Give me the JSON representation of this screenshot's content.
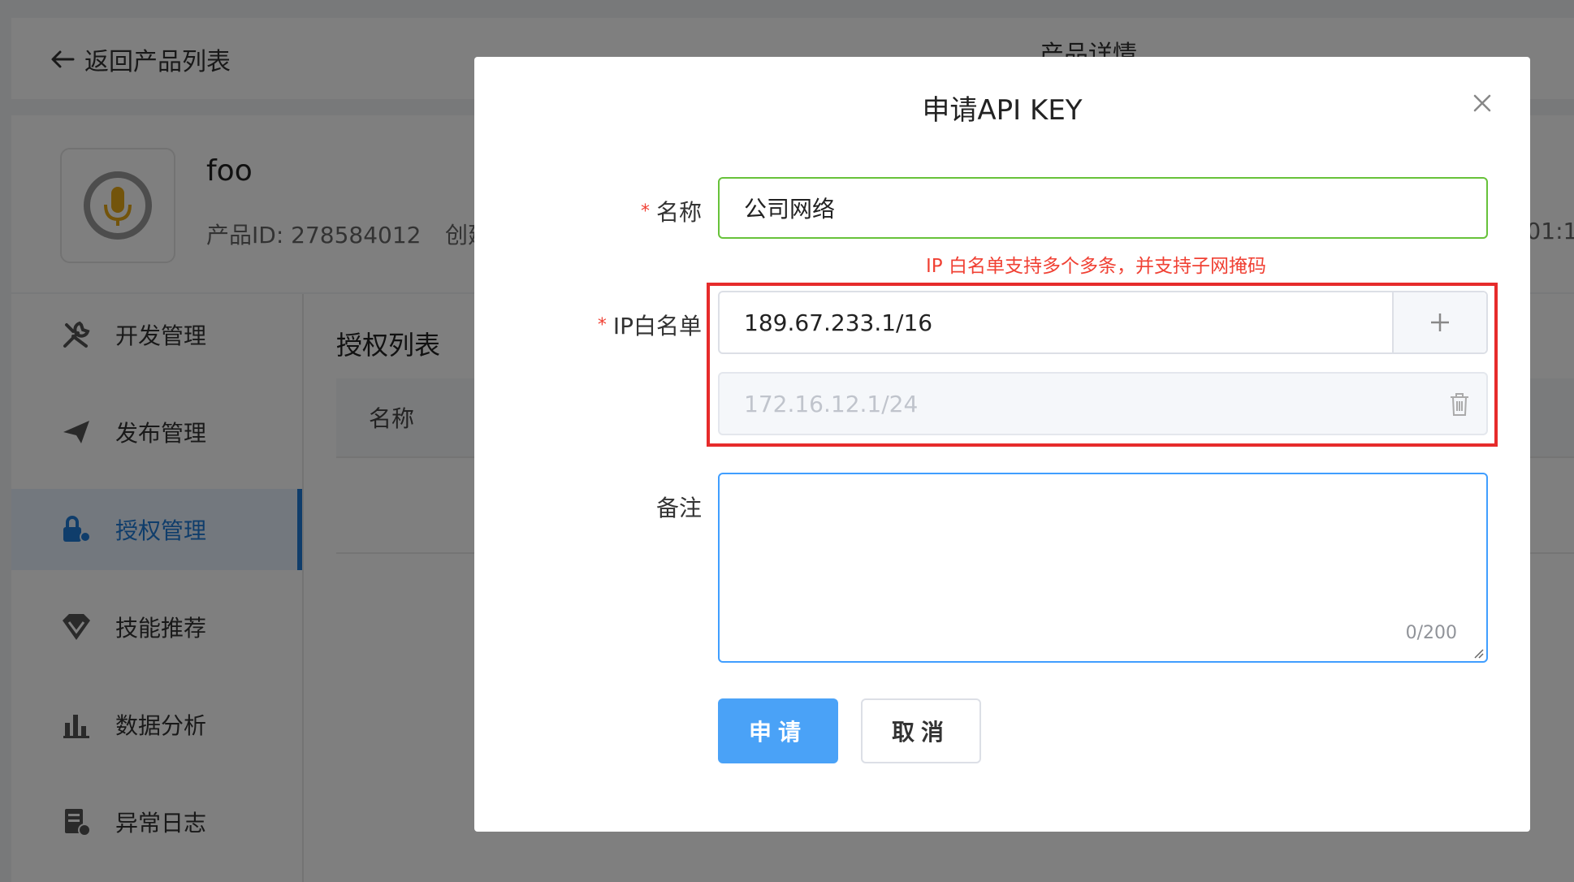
{
  "header": {
    "back_label": "返回产品列表",
    "title": "产品详情"
  },
  "product": {
    "name": "foo",
    "id_text": "产品ID: 278584012",
    "create_text": "创建时间",
    "time_text": ":01:1"
  },
  "sidebar": {
    "items": [
      {
        "label": "开发管理",
        "icon": "tools-icon"
      },
      {
        "label": "发布管理",
        "icon": "paper-plane-icon"
      },
      {
        "label": "授权管理",
        "icon": "lock-gear-icon",
        "active": true
      },
      {
        "label": "技能推荐",
        "icon": "diamond-icon"
      },
      {
        "label": "数据分析",
        "icon": "bar-chart-icon"
      },
      {
        "label": "异常日志",
        "icon": "log-icon"
      }
    ]
  },
  "content": {
    "title": "授权列表",
    "columns": [
      "名称"
    ]
  },
  "modal": {
    "title": "申请API KEY",
    "name_label": "名称",
    "name_value": "公司网络",
    "hint": "IP 白名单支持多个多条，并支持子网掩码",
    "ip_label": "IP白名单",
    "ip_values": [
      "189.67.233.1/16",
      "172.16.12.1/24"
    ],
    "note_label": "备注",
    "note_value": "",
    "note_counter": "0/200",
    "submit_label": "申请",
    "cancel_label": "取消"
  },
  "colors": {
    "primary": "#4aa2f7",
    "success_border": "#67c23a",
    "error": "#f04134",
    "highlight_box": "#e62b2b",
    "active_nav": "#1f7ad6"
  }
}
